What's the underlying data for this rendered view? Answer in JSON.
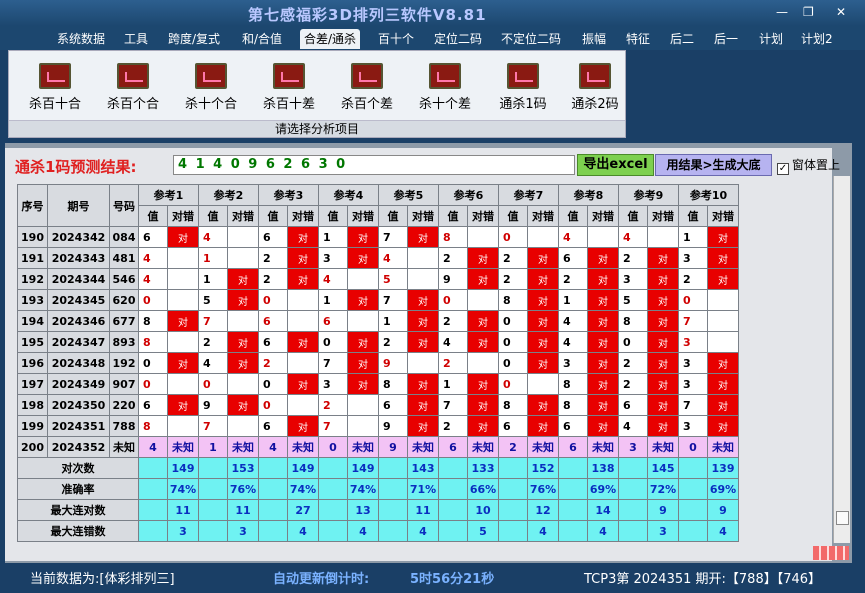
{
  "window": {
    "title": "第七感福彩3D排列三软件V8.81",
    "minimize": "—",
    "maximize": "❐",
    "close": "✕"
  },
  "menu": [
    "系统数据",
    "工具",
    "跨度/复式",
    "和/合值",
    "合差/通杀",
    "百十个",
    "定位二码",
    "不定位二码",
    "振幅",
    "特征",
    "后二",
    "后一",
    "计划",
    "计划2"
  ],
  "menu_active_index": 4,
  "ribbon": {
    "items": [
      "杀百十合",
      "杀百个合",
      "杀十个合",
      "杀百十差",
      "杀百个差",
      "杀十个差",
      "通杀1码",
      "通杀2码"
    ],
    "footer": "请选择分析项目"
  },
  "prediction": {
    "label": "通杀1码预测结果:",
    "value": "4 1 4 0 9 6 2 6 3 0",
    "excel_button": "导出excel",
    "generate_button": "用结果>生成大底",
    "pin_label": "窗体置上",
    "pin_checked": true
  },
  "table": {
    "col_seq": "序号",
    "col_issue": "期号",
    "col_num": "号码",
    "ref_headers": [
      "参考1",
      "参考2",
      "参考3",
      "参考4",
      "参考5",
      "参考6",
      "参考7",
      "参考8",
      "参考9",
      "参考10"
    ],
    "sub_value": "值",
    "sub_check": "对错",
    "ok_text": "对",
    "rows": [
      {
        "seq": "190",
        "issue": "2024342",
        "num": "084",
        "values": [
          "6",
          "4",
          "6",
          "1",
          "7",
          "8",
          "0",
          "4",
          "4",
          "1"
        ],
        "ok": [
          1,
          0,
          1,
          1,
          1,
          0,
          0,
          0,
          0,
          1
        ]
      },
      {
        "seq": "191",
        "issue": "2024343",
        "num": "481",
        "values": [
          "4",
          "1",
          "2",
          "3",
          "4",
          "2",
          "2",
          "6",
          "2",
          "3"
        ],
        "ok": [
          0,
          0,
          1,
          1,
          0,
          1,
          1,
          1,
          1,
          1
        ]
      },
      {
        "seq": "192",
        "issue": "2024344",
        "num": "546",
        "values": [
          "4",
          "1",
          "2",
          "4",
          "5",
          "9",
          "2",
          "2",
          "3",
          "2"
        ],
        "ok": [
          0,
          1,
          1,
          0,
          0,
          1,
          1,
          1,
          1,
          1
        ]
      },
      {
        "seq": "193",
        "issue": "2024345",
        "num": "620",
        "values": [
          "0",
          "5",
          "0",
          "1",
          "7",
          "0",
          "8",
          "1",
          "5",
          "0"
        ],
        "ok": [
          0,
          1,
          0,
          1,
          1,
          0,
          1,
          1,
          1,
          0
        ]
      },
      {
        "seq": "194",
        "issue": "2024346",
        "num": "677",
        "values": [
          "8",
          "7",
          "6",
          "6",
          "1",
          "2",
          "0",
          "4",
          "8",
          "7"
        ],
        "ok": [
          1,
          0,
          0,
          0,
          1,
          1,
          1,
          1,
          1,
          0
        ]
      },
      {
        "seq": "195",
        "issue": "2024347",
        "num": "893",
        "values": [
          "8",
          "2",
          "6",
          "0",
          "2",
          "4",
          "0",
          "4",
          "0",
          "3"
        ],
        "ok": [
          0,
          1,
          1,
          1,
          1,
          1,
          1,
          1,
          1,
          0
        ]
      },
      {
        "seq": "196",
        "issue": "2024348",
        "num": "192",
        "values": [
          "0",
          "4",
          "2",
          "7",
          "9",
          "2",
          "0",
          "3",
          "2",
          "3"
        ],
        "ok": [
          1,
          1,
          0,
          1,
          0,
          0,
          1,
          1,
          1,
          1
        ]
      },
      {
        "seq": "197",
        "issue": "2024349",
        "num": "907",
        "values": [
          "0",
          "0",
          "0",
          "3",
          "8",
          "1",
          "0",
          "8",
          "2",
          "3"
        ],
        "ok": [
          0,
          0,
          1,
          1,
          1,
          1,
          0,
          1,
          1,
          1
        ]
      },
      {
        "seq": "198",
        "issue": "2024350",
        "num": "220",
        "values": [
          "6",
          "9",
          "0",
          "2",
          "6",
          "7",
          "8",
          "8",
          "6",
          "7"
        ],
        "ok": [
          1,
          1,
          0,
          0,
          1,
          1,
          1,
          1,
          1,
          1
        ]
      },
      {
        "seq": "199",
        "issue": "2024351",
        "num": "788",
        "values": [
          "8",
          "7",
          "6",
          "7",
          "9",
          "2",
          "6",
          "6",
          "4",
          "3"
        ],
        "ok": [
          0,
          0,
          1,
          0,
          1,
          1,
          1,
          1,
          1,
          1
        ]
      }
    ],
    "last_row": {
      "seq": "200",
      "issue": "2024352",
      "num": "未知",
      "values": [
        "4",
        "1",
        "4",
        "0",
        "9",
        "6",
        "2",
        "6",
        "3",
        "0"
      ],
      "unknown": "未知"
    },
    "stats": [
      {
        "label": "对次数",
        "values": [
          "149",
          "153",
          "149",
          "149",
          "143",
          "133",
          "152",
          "138",
          "145",
          "139"
        ]
      },
      {
        "label": "准确率",
        "values": [
          "74%",
          "76%",
          "74%",
          "74%",
          "71%",
          "66%",
          "76%",
          "69%",
          "72%",
          "69%"
        ]
      },
      {
        "label": "最大连对数",
        "values": [
          "11",
          "11",
          "27",
          "13",
          "11",
          "10",
          "12",
          "14",
          "9",
          "9"
        ]
      },
      {
        "label": "最大连错数",
        "values": [
          "3",
          "3",
          "4",
          "4",
          "4",
          "5",
          "4",
          "4",
          "3",
          "4"
        ]
      }
    ]
  },
  "status": {
    "source": "当前数据为:[体彩排列三]",
    "timer_label": "自动更新倒计时:",
    "timer_value": "5时56分21秒",
    "latest": "TCP3第 2024351 期开:【788】【746】"
  }
}
